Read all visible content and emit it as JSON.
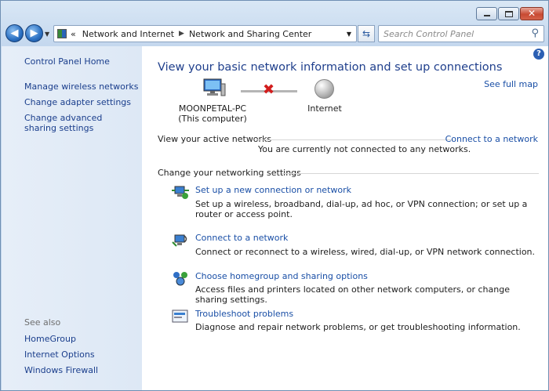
{
  "caption": {
    "close_glyph": "✕"
  },
  "nav": {
    "back_glyph": "◀",
    "forward_glyph": "▶",
    "address": {
      "prefix": "«",
      "crumbs": [
        "Network and Internet",
        "Network and Sharing Center"
      ]
    },
    "search_placeholder": "Search Control Panel"
  },
  "sidebar": {
    "home": "Control Panel Home",
    "links": [
      "Manage wireless networks",
      "Change adapter settings",
      "Change advanced sharing settings"
    ],
    "see_also": "See also",
    "see_also_links": [
      "HomeGroup",
      "Internet Options",
      "Windows Firewall"
    ]
  },
  "main": {
    "heading": "View your basic network information and set up connections",
    "see_full_map": "See full map",
    "computer": {
      "name": "MOONPETAL-PC",
      "sub": "(This computer)"
    },
    "internet": "Internet",
    "active_networks_label": "View your active networks",
    "connect_link": "Connect to a network",
    "not_connected": "You are currently not connected to any networks.",
    "change_settings_label": "Change your networking settings",
    "tasks": [
      {
        "title": "Set up a new connection or network",
        "desc": "Set up a wireless, broadband, dial-up, ad hoc, or VPN connection; or set up a router or access point."
      },
      {
        "title": "Connect to a network",
        "desc": "Connect or reconnect to a wireless, wired, dial-up, or VPN network connection."
      },
      {
        "title": "Choose homegroup and sharing options",
        "desc": "Access files and printers located on other network computers, or change sharing settings."
      },
      {
        "title": "Troubleshoot problems",
        "desc": "Diagnose and repair network problems, or get troubleshooting information."
      }
    ]
  }
}
